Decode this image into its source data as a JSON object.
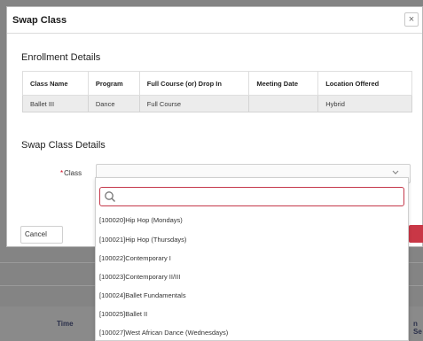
{
  "modal": {
    "title": "Swap Class",
    "close_glyph": "×"
  },
  "enrollment": {
    "heading": "Enrollment Details",
    "columns": [
      "Class Name",
      "Program",
      "Full Course (or) Drop In",
      "Meeting Date",
      "Location Offered"
    ],
    "rows": [
      [
        "Ballet III",
        "Dance",
        "Full Course",
        "",
        "Hybrid"
      ]
    ]
  },
  "swap": {
    "heading": "Swap Class Details",
    "class_label": "Class",
    "required_mark": "*",
    "selected_value": "",
    "search_value": "",
    "options": [
      "[100020]Hip Hop (Mondays)",
      "[100021]Hip Hop (Thursdays)",
      "[100022]Contemporary I",
      "[100023]Contemporary II/III",
      "[100024]Ballet Fundamentals",
      "[100025]Ballet II",
      "[100027]West African Dance (Wednesdays)"
    ]
  },
  "footer": {
    "cancel_label": "Cancel"
  },
  "background": {
    "time_label": "Time",
    "right_label": "n Se"
  },
  "colors": {
    "required": "#d0021b",
    "search_border": "#c4384a",
    "primary_button": "#c93746"
  }
}
